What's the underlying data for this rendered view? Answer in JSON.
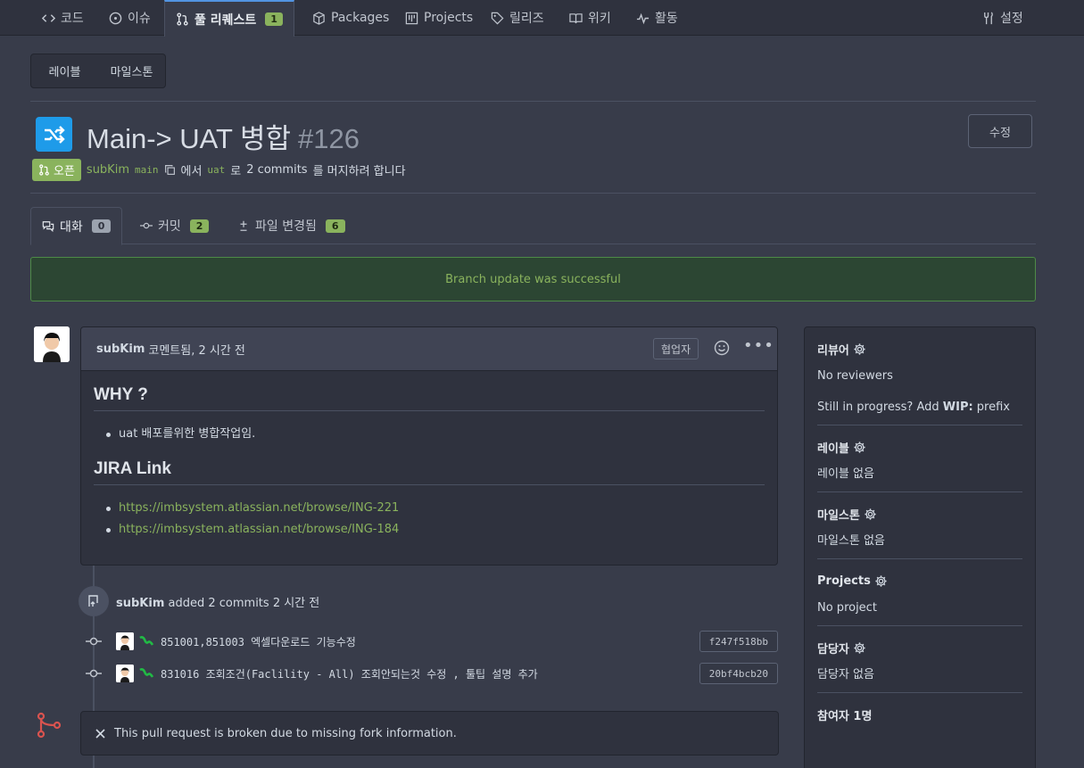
{
  "nav": {
    "items": [
      {
        "label": "코드",
        "icon": "code-icon"
      },
      {
        "label": "이슈",
        "icon": "issue-icon"
      },
      {
        "label": "풀 리퀘스트",
        "icon": "pull-request-icon",
        "badge": "1"
      },
      {
        "label": "Packages",
        "icon": "package-icon"
      },
      {
        "label": "Projects",
        "icon": "project-icon"
      },
      {
        "label": "릴리즈",
        "icon": "tag-icon"
      },
      {
        "label": "위키",
        "icon": "book-icon"
      },
      {
        "label": "활동",
        "icon": "pulse-icon"
      }
    ],
    "settings": "설정"
  },
  "filters": {
    "labels": "레이블",
    "milestones": "마일스톤"
  },
  "pr": {
    "title": "Main-> UAT 병합",
    "number": "#126",
    "edit": "수정",
    "state": "오픈",
    "author": "subKim",
    "head_branch": "main",
    "text_from": "에서",
    "base_branch": "uat",
    "text_to": "로",
    "commits_count": "2 commits",
    "text_merge": "를 머지하려 합니다"
  },
  "tabs": [
    {
      "label": "대화",
      "count": "0"
    },
    {
      "label": "커밋",
      "count": "2"
    },
    {
      "label": "파일 변경됨",
      "count": "6"
    }
  ],
  "flash": "Branch update was successful",
  "comment": {
    "author": "subKim",
    "meta": "코멘트됨, 2 시간 전",
    "collaborator": "협업자",
    "h1": "WHY ?",
    "why_items": [
      "uat 배포를위한 병합작업임."
    ],
    "h2": "JIRA Link",
    "links": [
      "https://imbsystem.atlassian.net/browse/ING-221",
      "https://imbsystem.atlassian.net/browse/ING-184"
    ]
  },
  "push": {
    "author": "subKim",
    "text": "added 2 commits 2 시간 전"
  },
  "commits": [
    {
      "message": "851001,851003 엑셀다운로드 기능수정",
      "sha": "f247f518bb"
    },
    {
      "message": "831016 조회조건(Faclility - All) 조회안되는것 수정 , 툴팁 설명 추가",
      "sha": "20bf4bcb20"
    }
  ],
  "broken": "This pull request is broken due to missing fork information.",
  "sidebar": {
    "reviewers_title": "리뷰어",
    "reviewers_value": "No reviewers",
    "wip_prefix": "Still in progress? Add ",
    "wip_bold": "WIP:",
    "wip_suffix": " prefix",
    "labels_title": "레이블",
    "labels_value": "레이블 없음",
    "milestone_title": "마일스톤",
    "milestone_value": "마일스톤 없음",
    "projects_title": "Projects",
    "projects_value": "No project",
    "assignees_title": "담당자",
    "assignees_value": "담당자 없음",
    "participants_title": "참여자 1명"
  },
  "colors": {
    "accent_green": "#8ab35d",
    "brand_blue": "#1e9be9",
    "danger_red": "#d9534f"
  }
}
